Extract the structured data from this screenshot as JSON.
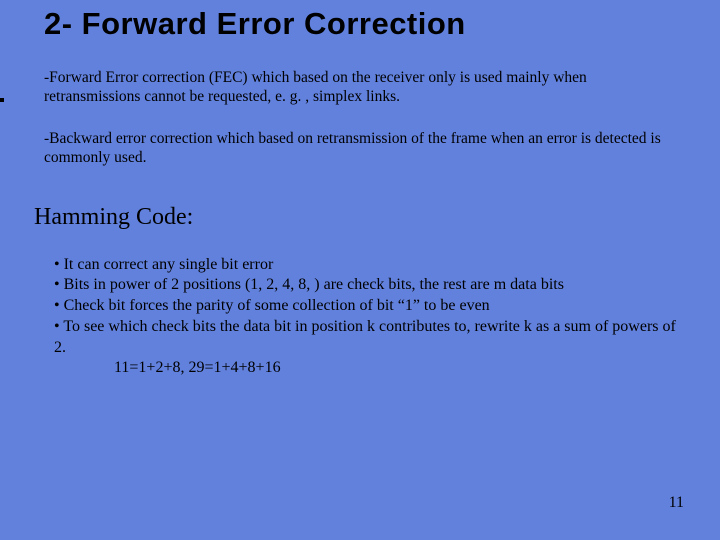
{
  "title": "2- Forward Error Correction",
  "intro": {
    "p1": "-Forward Error correction (FEC) which based on the receiver only is used mainly when retransmissions cannot be requested, e. g. , simplex links.",
    "p2": "-Backward error correction which based on retransmission of the frame when an error is detected is commonly used."
  },
  "section_heading": "Hamming Code:",
  "bullets": {
    "b1": "• It can correct any single bit error",
    "b2": "• Bits in power of 2 positions (1, 2, 4, 8, ) are check bits, the rest are m data bits",
    "b3": "• Check bit forces the parity of some collection of bit “1” to be even",
    "b4": "• To see which check bits the data bit in position k contributes to, rewrite k as a sum of powers of 2.",
    "sums": "11=1+2+8, 29=1+4+8+16"
  },
  "page_number": "11"
}
